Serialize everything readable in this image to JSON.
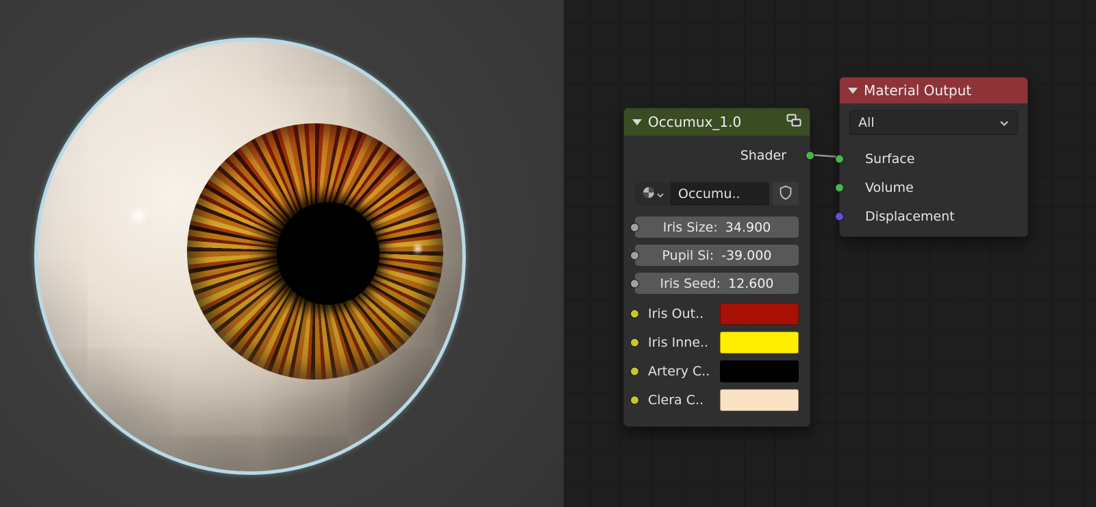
{
  "viewport": {
    "eye_outline_color": "#b7dae6",
    "sclera_color": "#ece2d6",
    "iris_primary_color": "#c07818",
    "pupil_color": "#000000"
  },
  "node_editor": {
    "background_color": "#1e1e1e",
    "link_color": "#9a9a9a",
    "occumux_node": {
      "title": "Occumux_1.0",
      "header_color": "#3a4d22",
      "output": {
        "label": "Shader",
        "socket_color": "#4db34d"
      },
      "material_selector": {
        "name": "Occumu.."
      },
      "value_fields": [
        {
          "label": "Iris Size:",
          "value": "34.900",
          "socket_color": "#a1a1a1"
        },
        {
          "label": "Pupil Si:",
          "value": "-39.000",
          "socket_color": "#a1a1a1"
        },
        {
          "label": "Iris Seed:",
          "value": "12.600",
          "socket_color": "#a1a1a1"
        }
      ],
      "color_inputs": [
        {
          "label": "Iris Out..",
          "color": "#a81005",
          "socket_color": "#c7c729"
        },
        {
          "label": "Iris Inne..",
          "color": "#ffee00",
          "socket_color": "#c7c729"
        },
        {
          "label": "Artery C..",
          "color": "#000000",
          "socket_color": "#c7c729"
        },
        {
          "label": "Clera C..",
          "color": "#fbe2c4",
          "socket_color": "#c7c729"
        }
      ]
    },
    "material_output_node": {
      "title": "Material Output",
      "header_color": "#8e3338",
      "target_dropdown": {
        "value": "All"
      },
      "inputs": [
        {
          "label": "Surface",
          "socket_color": "#4db34d"
        },
        {
          "label": "Volume",
          "socket_color": "#4db34d"
        },
        {
          "label": "Displacement",
          "socket_color": "#5c50dc"
        }
      ]
    }
  }
}
